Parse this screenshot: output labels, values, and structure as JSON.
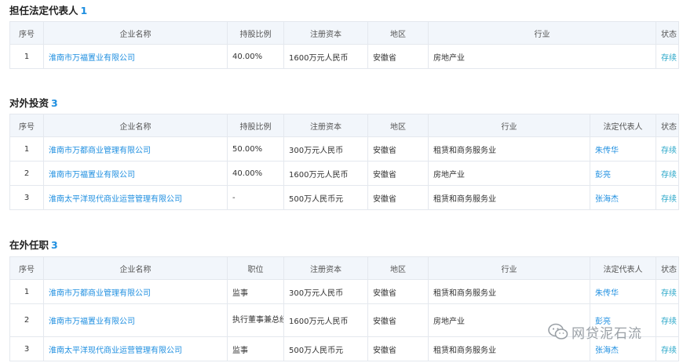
{
  "sections": {
    "legal_rep": {
      "title": "担任法定代表人",
      "count": "1",
      "headers": [
        "序号",
        "企业名称",
        "持股比例",
        "注册资本",
        "地区",
        "行业",
        "状态"
      ],
      "rows": [
        {
          "no": "1",
          "company": "淮南市万福置业有限公司",
          "ratio": "40.00%",
          "capital": "1600万元人民币",
          "region": "安徽省",
          "industry": "房地产业",
          "status": "存续"
        }
      ]
    },
    "investment": {
      "title": "对外投资",
      "count": "3",
      "headers": [
        "序号",
        "企业名称",
        "持股比例",
        "注册资本",
        "地区",
        "行业",
        "法定代表人",
        "状态"
      ],
      "rows": [
        {
          "no": "1",
          "company": "淮南市万都商业管理有限公司",
          "ratio": "50.00%",
          "capital": "300万元人民币",
          "region": "安徽省",
          "industry": "租赁和商务服务业",
          "rep": "朱传华",
          "status": "存续"
        },
        {
          "no": "2",
          "company": "淮南市万福置业有限公司",
          "ratio": "40.00%",
          "capital": "1600万元人民币",
          "region": "安徽省",
          "industry": "房地产业",
          "rep": "彭亮",
          "status": "存续"
        },
        {
          "no": "3",
          "company": "淮南太平洋现代商业运营管理有限公司",
          "ratio": "-",
          "capital": "500万人民币元",
          "region": "安徽省",
          "industry": "租赁和商务服务业",
          "rep": "张海杰",
          "status": "存续"
        }
      ]
    },
    "positions": {
      "title": "在外任职",
      "count": "3",
      "headers": [
        "序号",
        "企业名称",
        "职位",
        "注册资本",
        "地区",
        "行业",
        "法定代表人",
        "状态"
      ],
      "rows": [
        {
          "no": "1",
          "company": "淮南市万都商业管理有限公司",
          "position": "监事",
          "capital": "300万元人民币",
          "region": "安徽省",
          "industry": "租赁和商务服务业",
          "rep": "朱传华",
          "status": "存续"
        },
        {
          "no": "2",
          "company": "淮南市万福置业有限公司",
          "position": "执行董事兼总经理",
          "capital": "1600万元人民币",
          "region": "安徽省",
          "industry": "房地产业",
          "rep": "彭亮",
          "status": "存续"
        },
        {
          "no": "3",
          "company": "淮南太平洋现代商业运营管理有限公司",
          "position": "监事",
          "capital": "500万人民币元",
          "region": "安徽省",
          "industry": "租赁和商务服务业",
          "rep": "张海杰",
          "status": "存续"
        }
      ]
    }
  },
  "watermark": {
    "text": "网贷泥石流",
    "icon": "wechat-icon"
  },
  "colors": {
    "link": "#1f8fe0",
    "status": "#2aa7c9",
    "header_bg": "#f2f6fb",
    "border": "#e4e8ee"
  }
}
